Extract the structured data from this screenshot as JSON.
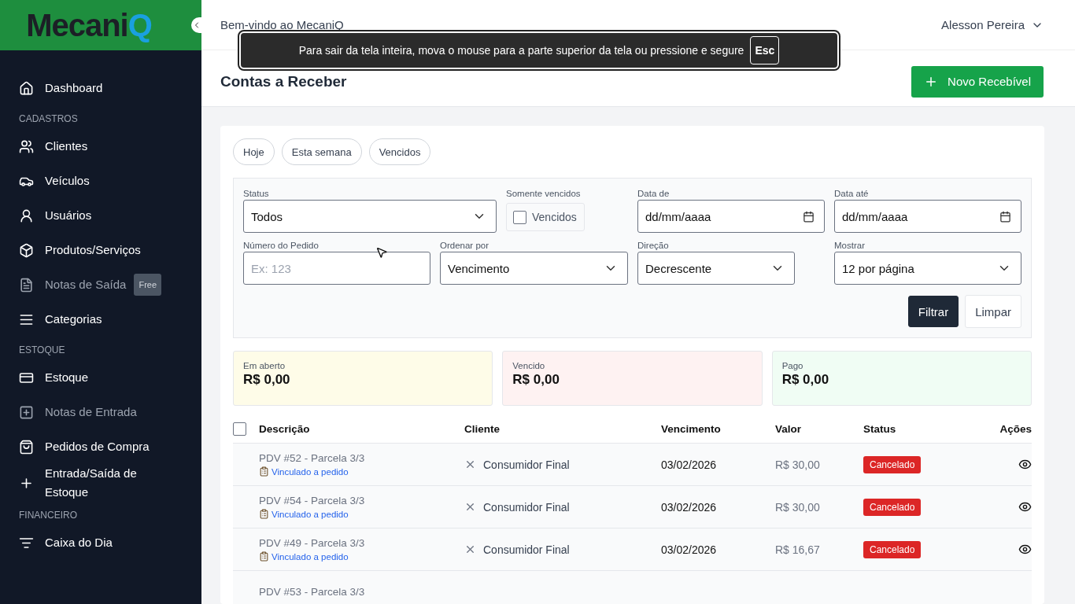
{
  "logo": {
    "text": "Mecani",
    "accent": "Q"
  },
  "sidebar": {
    "items": [
      {
        "kind": "item",
        "label": "Dashboard",
        "disabled": false
      },
      {
        "kind": "section",
        "label": "CADASTROS"
      },
      {
        "kind": "item",
        "label": "Clientes",
        "disabled": false
      },
      {
        "kind": "item",
        "label": "Veículos",
        "disabled": false
      },
      {
        "kind": "item",
        "label": "Usuários",
        "disabled": false
      },
      {
        "kind": "item",
        "label": "Produtos/Serviços",
        "disabled": false
      },
      {
        "kind": "item",
        "label": "Notas de Saída",
        "disabled": true,
        "badge": "Free"
      },
      {
        "kind": "item",
        "label": "Categorias",
        "disabled": false
      },
      {
        "kind": "section",
        "label": "ESTOQUE"
      },
      {
        "kind": "item",
        "label": "Estoque",
        "disabled": false
      },
      {
        "kind": "item",
        "label": "Notas de Entrada",
        "disabled": true
      },
      {
        "kind": "item",
        "label": "Pedidos de Compra",
        "disabled": false
      },
      {
        "kind": "item",
        "label": "Entrada/Saída de Estoque",
        "disabled": false
      },
      {
        "kind": "section",
        "label": "FINANCEIRO"
      },
      {
        "kind": "item",
        "label": "Caixa do Dia",
        "disabled": false
      }
    ]
  },
  "header": {
    "welcome": "Bem-vindo ao MecaniQ",
    "user": "Alesson Pereira"
  },
  "toast": {
    "message": "Para sair da tela inteira, mova o mouse para a parte superior da tela ou pressione e segure",
    "key": "Esc"
  },
  "page": {
    "title": "Contas a Receber",
    "action": "Novo Recebível"
  },
  "quick_filters": [
    {
      "label": "Hoje",
      "selected": false
    },
    {
      "label": "Esta semana",
      "selected": false
    },
    {
      "label": "Vencidos",
      "selected": false
    }
  ],
  "filters": {
    "status": {
      "label": "Status",
      "value": "Todos"
    },
    "overdue": {
      "label": "Somente vencidos",
      "option": "Vencidos",
      "checked": false
    },
    "date_from": {
      "label": "Data de",
      "value": "dd/mm/aaaa"
    },
    "date_to": {
      "label": "Data até",
      "value": "dd/mm/aaaa"
    },
    "order_number": {
      "label": "Número do Pedido",
      "placeholder": "Ex: 123"
    },
    "order_by": {
      "label": "Ordenar por",
      "value": "Vencimento"
    },
    "direction": {
      "label": "Direção",
      "value": "Decrescente"
    },
    "per_page": {
      "label": "Mostrar",
      "value": "12 por página"
    },
    "buttons": [
      {
        "kind": "primary",
        "label": "Filtrar"
      },
      {
        "kind": "secondary",
        "label": "Limpar"
      }
    ]
  },
  "summary": [
    {
      "label": "Em aberto",
      "value": "R$ 0,00",
      "color": "#fefce8"
    },
    {
      "label": "Vencido",
      "value": "R$ 0,00",
      "color": "#fef2f2"
    },
    {
      "label": "Pago",
      "value": "R$ 0,00",
      "color": "#f0fdf4"
    }
  ],
  "table": {
    "select_all_checked": false,
    "columns": [
      "Descrição",
      "Cliente",
      "Vencimento",
      "Valor",
      "Status",
      "Ações"
    ],
    "rows": [
      {
        "description": "PDV #52 - Parcela 3/3",
        "link": "Vinculado a pedido",
        "client": "Consumidor Final",
        "due": "03/02/2026",
        "value": "R$ 30,00",
        "status": "Cancelado"
      },
      {
        "description": "PDV #54 - Parcela 3/3",
        "link": "Vinculado a pedido",
        "client": "Consumidor Final",
        "due": "03/02/2026",
        "value": "R$ 30,00",
        "status": "Cancelado"
      },
      {
        "description": "PDV #49 - Parcela 3/3",
        "link": "Vinculado a pedido",
        "client": "Consumidor Final",
        "due": "03/02/2026",
        "value": "R$ 16,67",
        "status": "Cancelado"
      },
      {
        "description": "PDV #53 - Parcela 3/3"
      }
    ]
  }
}
